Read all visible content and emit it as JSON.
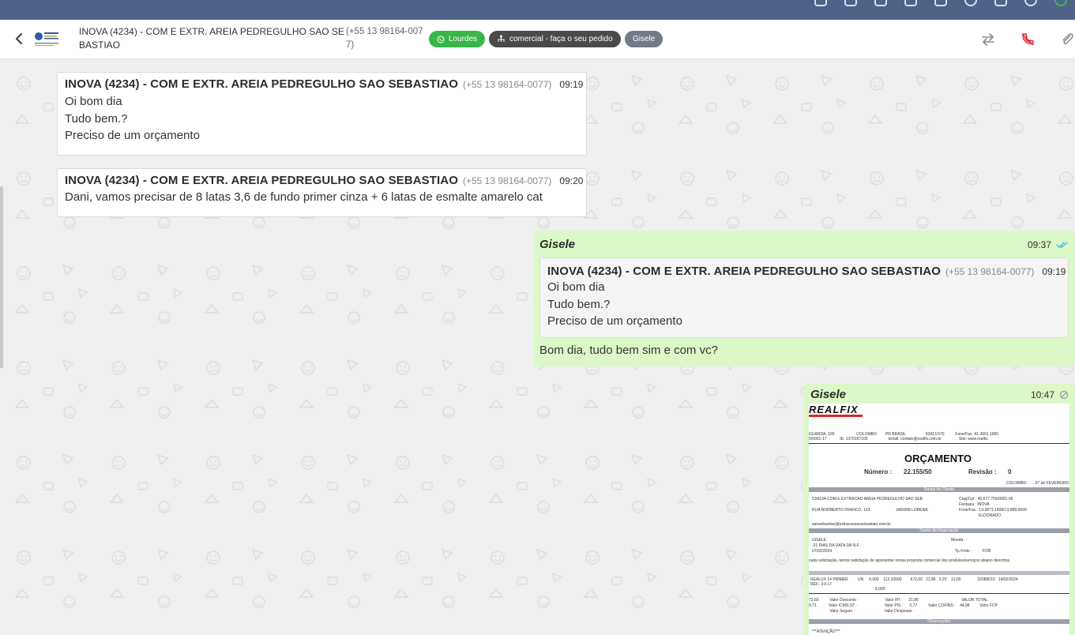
{
  "header": {
    "contact_name": "INOVA (4234) - COM E EXTR. AREIA PEDREGULHO SAO SEBASTIAO",
    "contact_phone": "(+55 13 98164-0077)",
    "tags": {
      "whatsapp": "Lourdes",
      "queue": "comercial - faça o seu pedido",
      "user": "Gisele"
    }
  },
  "messages": [
    {
      "sender": "INOVA (4234) - COM E EXTR. AREIA PEDREGULHO SAO SEBASTIAO",
      "phone": "(+55 13 98164-0077)",
      "time": "09:19",
      "lines": [
        "Oi bom dia",
        "Tudo bem.?",
        "Preciso de um orçamento"
      ]
    },
    {
      "sender": "INOVA (4234) - COM E EXTR. AREIA PEDREGULHO SAO SEBASTIAO",
      "phone": "(+55 13 98164-0077)",
      "time": "09:20",
      "lines": [
        "Dani, vamos precisar de 8 latas 3,6 de fundo primer cinza + 6 latas de esmalte amarelo cat"
      ]
    },
    {
      "sender": "Gisele",
      "time": "09:37",
      "status_icon": "double-check-icon",
      "quoted": {
        "sender": "INOVA (4234) - COM E EXTR. AREIA PEDREGULHO SAO SEBASTIAO",
        "phone": "(+55 13 98164-0077)",
        "time": "09:19",
        "lines": [
          "Oi bom dia",
          "Tudo bem.?",
          "Preciso de um orçamento"
        ]
      },
      "text": "Bom dia, tudo bem sim e com vc?"
    },
    {
      "sender": "Gisele",
      "time": "10:47",
      "status_icon": "clock-pending-icon",
      "document": {
        "brand": "REALFIX",
        "title": "ORÇAMENTO",
        "numero_label": "Número :",
        "numero": "22.155/50",
        "revisao_label": "Revisão :",
        "revisao": "0",
        "section_cliente": "Dados do Cliente",
        "section_negociacao": "Dados da Negociação",
        "section_observacoes": "Observações",
        "cliente": "C04234-COM E EXTRACAO AREIA PEDREGULHO SAO SEB",
        "endereco": "RUA NORBERTO FRANCO, 153",
        "bairro": "JARDIM LORENA",
        "cidade": "ELDORADO",
        "vendedor": "GISELE",
        "pagamento": "-21 DIAS DA DATA DA N.F.",
        "data": "07/02/2024",
        "frete": "FOB",
        "intro": "zada solicitação, temos satisfação de apresentar nossa proposta comercial dos produtos/serviços abaixo descritos",
        "item": "REALUX 14 PRIMER",
        "item_ref": "REF.: 3,6 LT",
        "atencao": "***ATENÇÃO***"
      }
    }
  ],
  "colors": {
    "topbar": "#4f6289",
    "whatsapp_tag": "#39b54a",
    "outgoing_bubble": "#dcf8c6",
    "read_check": "#4fb6ec",
    "call_end_icon": "#e0303a"
  }
}
